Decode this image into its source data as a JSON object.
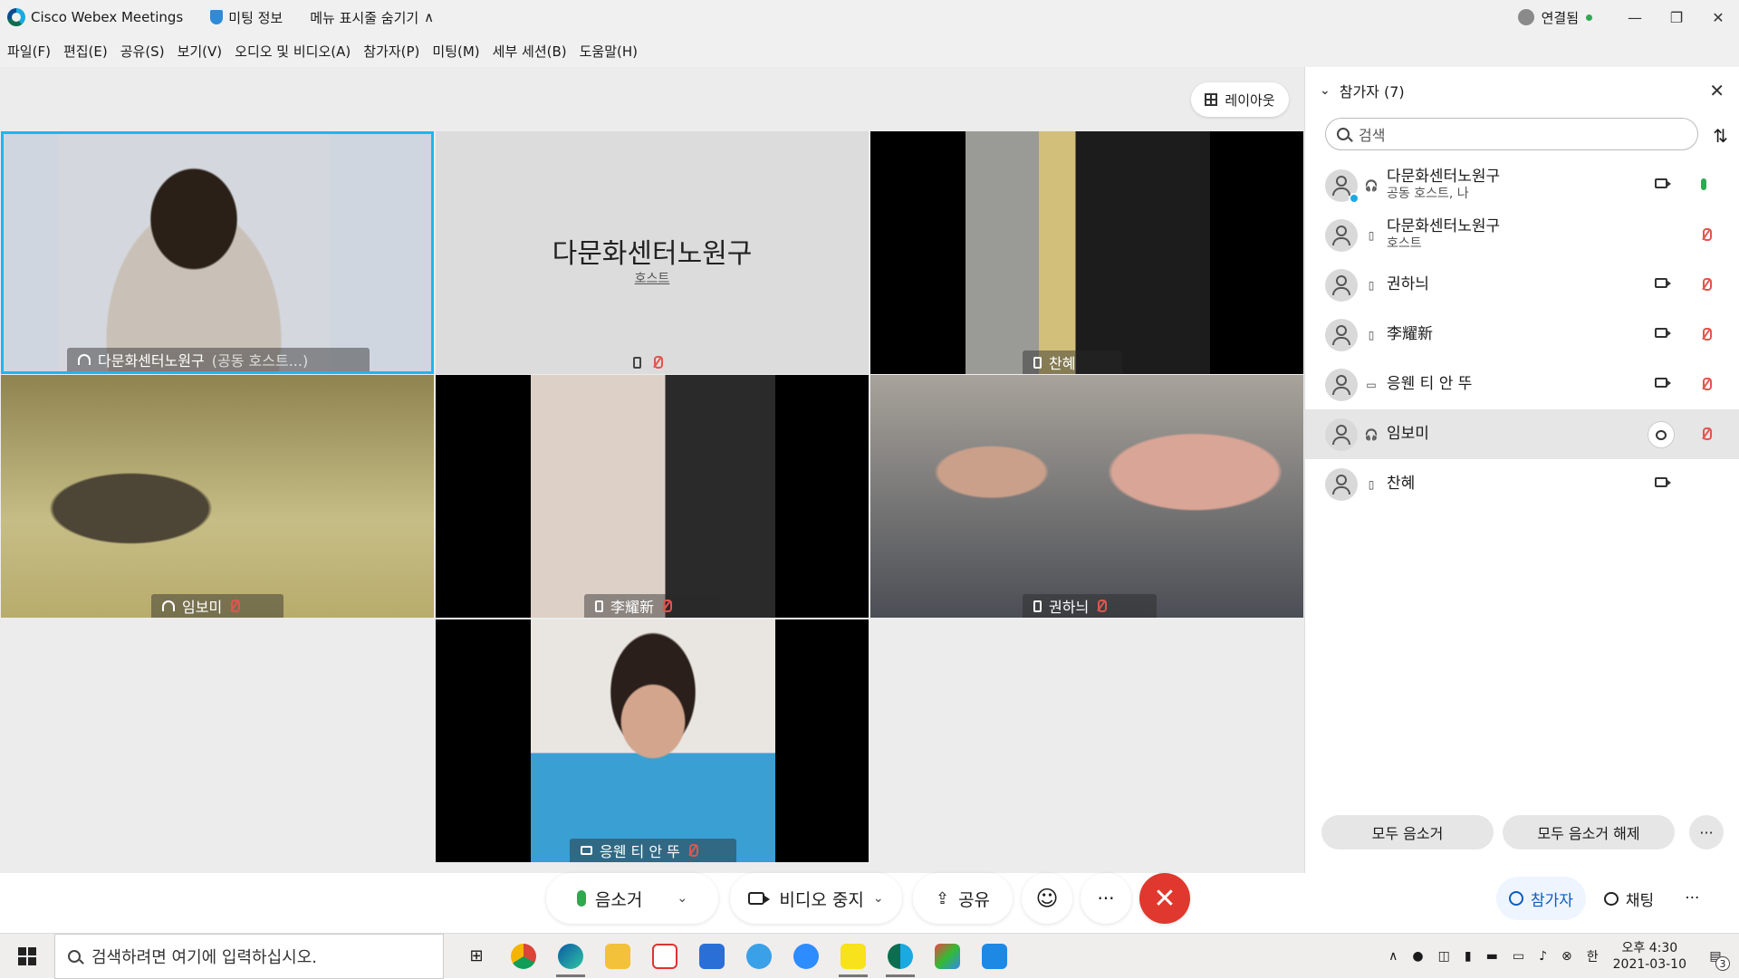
{
  "titlebar": {
    "app_name": "Cisco Webex Meetings",
    "meeting_info": "미팅 정보",
    "hide_menu": "메뉴 표시줄 숨기기",
    "hide_menu_arrow": "∧",
    "connection": "연결됨",
    "minimize": "—",
    "restore": "❐",
    "close": "✕"
  },
  "menu": [
    "파일(F)",
    "편집(E)",
    "공유(S)",
    "보기(V)",
    "오디오 및 비디오(A)",
    "참가자(P)",
    "미팅(M)",
    "세부 세션(B)",
    "도움말(H)"
  ],
  "layout_label": "레이아웃",
  "tiles": [
    {
      "name": "다문화센터노원구",
      "suffix": "(공동 호스트...)"
    },
    {
      "name": "다문화센터노원구",
      "role": "호스트"
    },
    {
      "name": "찬혜"
    },
    {
      "name": "임보미"
    },
    {
      "name": "李耀新"
    },
    {
      "name": "권하늬"
    },
    {
      "name": "응웬 티 안 뚜"
    }
  ],
  "controls": {
    "mute": "음소거",
    "stop_video": "비디오 중지",
    "share": "공유",
    "reactions": "☺",
    "more": "···",
    "end": "✕"
  },
  "panel": {
    "title": "참가자 (7)",
    "close": "✕",
    "search_placeholder": "검색",
    "participants": [
      {
        "name": "다문화센터노원구",
        "sub": "공동 호스트, 나",
        "type": "headset",
        "video": true,
        "mic": "on"
      },
      {
        "name": "다문화센터노원구",
        "sub": "호스트",
        "type": "phone",
        "video": false,
        "mic": "off"
      },
      {
        "name": "권하늬",
        "type": "phone",
        "video": true,
        "mic": "off"
      },
      {
        "name": "李耀新",
        "type": "phone",
        "video": true,
        "mic": "off"
      },
      {
        "name": "응웬 티 안 뚜",
        "type": "tablet",
        "video": true,
        "mic": "off"
      },
      {
        "name": "임보미",
        "type": "headset",
        "video": false,
        "chat": true,
        "mic": "off"
      },
      {
        "name": "찬혜",
        "type": "phone",
        "video": true,
        "mic": "none"
      }
    ],
    "mute_all": "모두 음소거",
    "unmute_all": "모두 음소거 해제",
    "more": "···"
  },
  "panel_tabs": {
    "participants": "참가자",
    "chat": "채팅",
    "more": "···"
  },
  "taskbar": {
    "search_placeholder": "검색하려면 여기에 입력하십시오.",
    "ime": "한",
    "time": "오후 4:30",
    "date": "2021-03-10",
    "notif_count": "3"
  }
}
